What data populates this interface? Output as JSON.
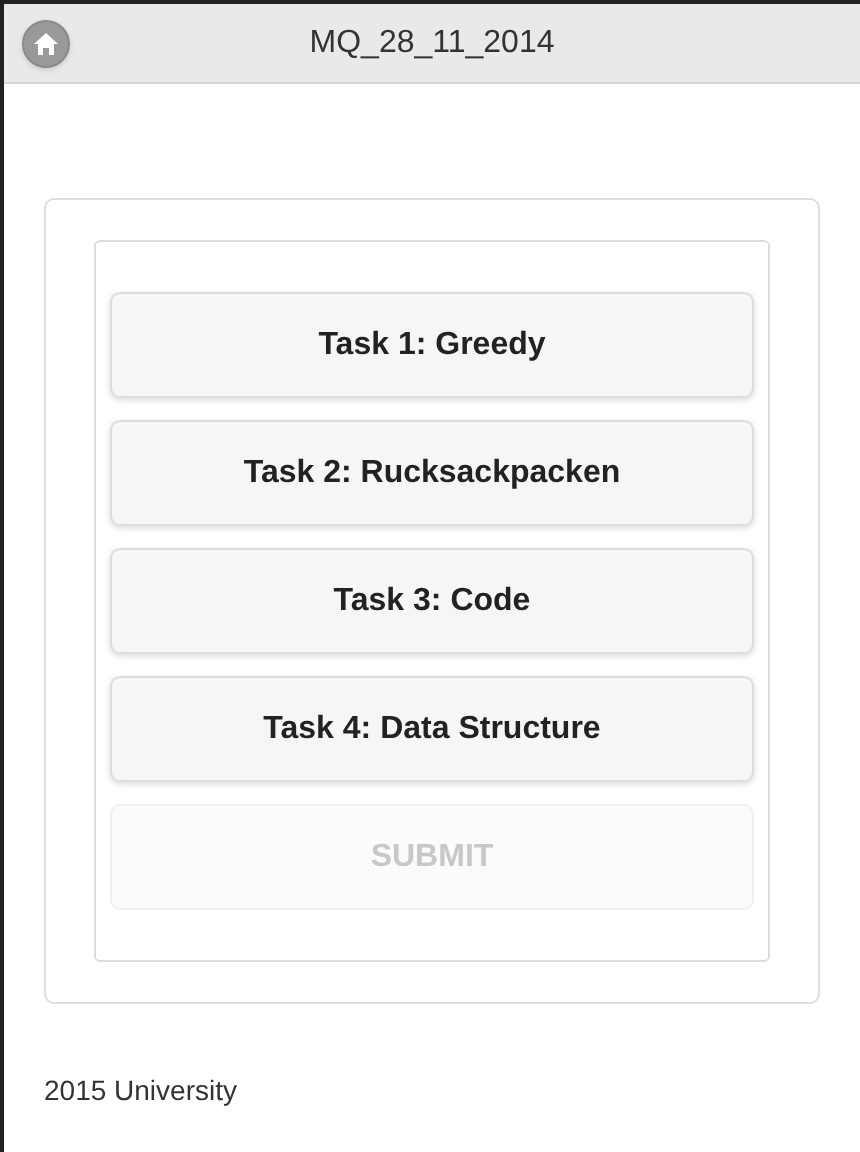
{
  "header": {
    "title": "MQ_28_11_2014"
  },
  "tasks": [
    {
      "label": "Task 1: Greedy"
    },
    {
      "label": "Task 2: Rucksackpacken"
    },
    {
      "label": "Task 3: Code"
    },
    {
      "label": "Task 4: Data Structure"
    }
  ],
  "submit": {
    "label": "SUBMIT",
    "disabled": true
  },
  "footer": {
    "text": "2015 University"
  }
}
